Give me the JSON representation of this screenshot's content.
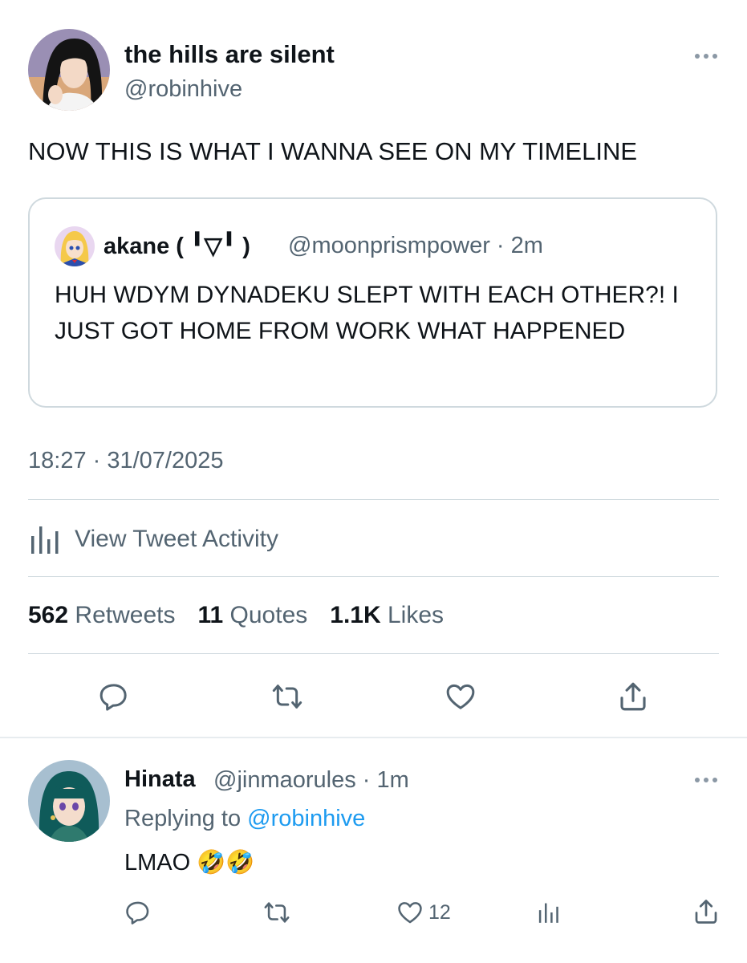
{
  "tweet": {
    "display_name": "the hills are silent",
    "handle": "@robinhive",
    "text": "NOW THIS IS WHAT I WANNA SEE ON MY TIMELINE",
    "timestamp": "18:27 · 31/07/2025",
    "icons": {
      "more": "more-horizontal-icon",
      "avatar": "avatar"
    }
  },
  "quote": {
    "display_name": "akane ( ╹▽╹ )",
    "handle_time": "@moonprismpower · 2m",
    "text": "HUH WDYM DYNADEKU SLEPT WITH EACH OTHER?! I JUST GOT HOME FROM WORK WHAT HAPPENED"
  },
  "activity": {
    "label": "View Tweet Activity",
    "icon": "analytics-icon"
  },
  "stats": {
    "retweets_count": "562",
    "retweets_label": "Retweets",
    "quotes_count": "11",
    "quotes_label": "Quotes",
    "likes_count": "1.1K",
    "likes_label": "Likes"
  },
  "actions": [
    "reply-icon",
    "retweet-icon",
    "like-icon",
    "share-icon"
  ],
  "reply": {
    "display_name": "Hinata",
    "handle_time": "@jinmaorules · 1m",
    "replying_prefix": "Replying to",
    "replying_handle": "@robinhive",
    "text": "LMAO 🤣🤣",
    "like_count": "12",
    "actions": [
      "reply-icon",
      "retweet-icon",
      "like-icon",
      "analytics-icon",
      "share-icon"
    ]
  },
  "colors": {
    "text": "#0f1419",
    "secondary": "#536471",
    "link": "#1d9bf0",
    "border": "#cfd9de"
  }
}
